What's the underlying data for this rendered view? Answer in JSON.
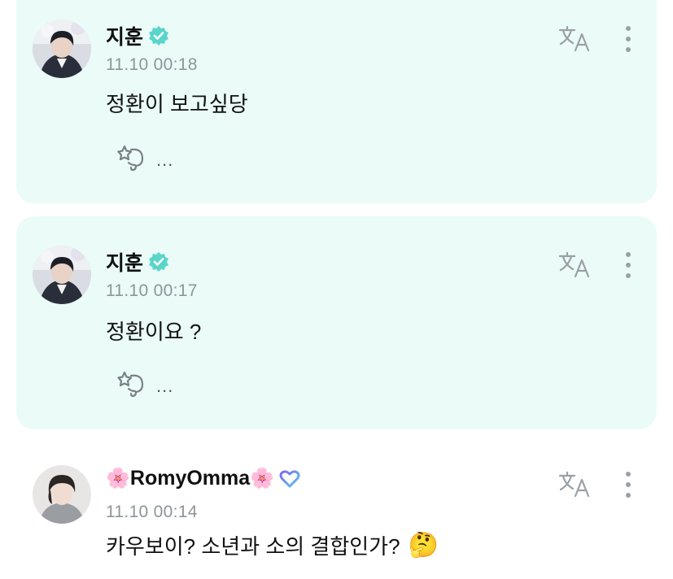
{
  "posts": [
    {
      "author": "지훈",
      "verified_color": "#5ad5c9",
      "time": "11.10 00:18",
      "message": "정환이 보고싶당",
      "reactions_more": "...",
      "highlighted": true
    },
    {
      "author": "지훈",
      "verified_color": "#5ad5c9",
      "time": "11.10 00:17",
      "message": "정환이요 ?",
      "reactions_more": "...",
      "highlighted": true
    },
    {
      "author": "RomyOmma",
      "author_prefix_icon": "cherry-blossom-icon",
      "author_suffix_icon": "cherry-blossom-icon",
      "badge_icon": "heart-outline-icon",
      "time": "11.10 00:14",
      "message": "카우보이? 소년과 소의 결합인가?",
      "message_emoji": "🤔",
      "highlighted": false
    }
  ],
  "colors": {
    "highlight_bg": "#eafbf8",
    "time": "#8e9599",
    "icon": "#9aa0a6",
    "verified": "#5ad5c9"
  }
}
